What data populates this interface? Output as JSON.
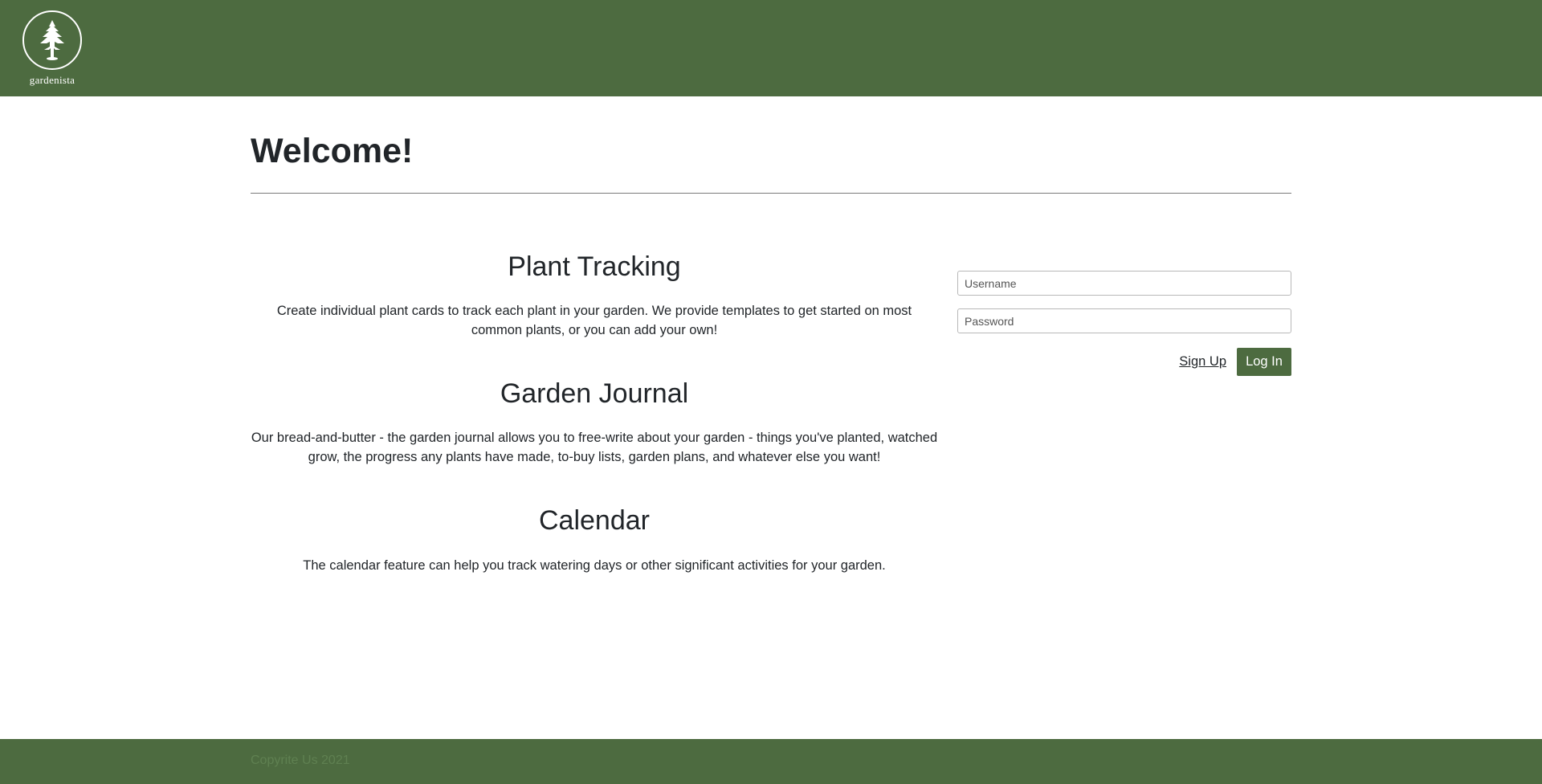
{
  "header": {
    "logo_text": "gardenista",
    "brand_color": "#4d6b40"
  },
  "main": {
    "title": "Welcome!",
    "features": [
      {
        "title": "Plant Tracking",
        "description": "Create individual plant cards to track each plant in your garden. We provide templates to get started on most common plants, or you can add your own!"
      },
      {
        "title": "Garden Journal",
        "description": "Our bread-and-butter - the garden journal allows you to free-write about your garden - things you've planted, watched grow, the progress any plants have made, to-buy lists, garden plans, and whatever else you want!"
      },
      {
        "title": "Calendar",
        "description": "The calendar feature can help you track watering days or other significant activities for your garden."
      }
    ]
  },
  "login": {
    "username_placeholder": "Username",
    "password_placeholder": "Password",
    "signup_label": "Sign Up",
    "login_label": "Log In"
  },
  "footer": {
    "copyright": "Copyrite Us 2021"
  }
}
